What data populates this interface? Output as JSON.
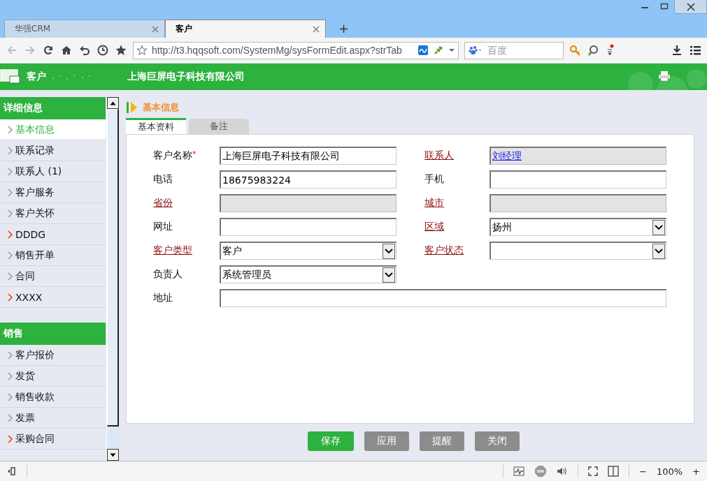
{
  "browser": {
    "tabs": [
      {
        "label": "华强CRM",
        "selected": false
      },
      {
        "label": "客户",
        "selected": true
      }
    ],
    "new_tab": "+",
    "address": "http://t3.hqqsoft.com/SystemMg/sysFormEdit.aspx?strTab",
    "search_placeholder": "百度"
  },
  "app_header": {
    "module": "客户",
    "company": "上海巨屏电子科技有限公司"
  },
  "sidebar": [
    {
      "title": "详细信息",
      "items": [
        {
          "label": "基本信息",
          "selected": true,
          "color": "#999999"
        },
        {
          "label": "联系记录",
          "selected": false,
          "color": "#999999"
        },
        {
          "label": "联系人 (1)",
          "selected": false,
          "color": "#999999"
        },
        {
          "label": "客户服务",
          "selected": false,
          "color": "#999999"
        },
        {
          "label": "客户关怀",
          "selected": false,
          "color": "#999999"
        },
        {
          "label": "DDDG",
          "selected": false,
          "color": "#d9400d"
        },
        {
          "label": "销售开单",
          "selected": false,
          "color": "#999999"
        },
        {
          "label": "合同",
          "selected": false,
          "color": "#999999"
        },
        {
          "label": "XXXX",
          "selected": false,
          "color": "#d9400d"
        }
      ]
    },
    {
      "title": "销售",
      "items": [
        {
          "label": "客户报价",
          "selected": false,
          "color": "#999999"
        },
        {
          "label": "发货",
          "selected": false,
          "color": "#999999"
        },
        {
          "label": "销售收款",
          "selected": false,
          "color": "#999999"
        },
        {
          "label": "发票",
          "selected": false,
          "color": "#999999"
        },
        {
          "label": "采购合同",
          "selected": false,
          "color": "#d9400d"
        }
      ]
    }
  ],
  "section_title": "基本信息",
  "required_mark": "*",
  "form_tabs": [
    {
      "label": "基本资料",
      "selected": true
    },
    {
      "label": "备注",
      "selected": false
    }
  ],
  "fields": [
    {
      "label": "客户名称",
      "required": true,
      "link": false,
      "kind": "text",
      "value": "上海巨屏电子科技有限公司",
      "disabled": false
    },
    {
      "label": "联系人",
      "required": false,
      "link": true,
      "kind": "link",
      "value": "刘经理",
      "disabled": true
    },
    {
      "label": "电话",
      "required": false,
      "link": false,
      "kind": "text",
      "value": "18675983224",
      "disabled": false
    },
    {
      "label": "手机",
      "required": false,
      "link": false,
      "kind": "text",
      "disabled": false
    },
    {
      "label": "省份",
      "required": false,
      "link": true,
      "kind": "text",
      "disabled": true
    },
    {
      "label": "城市",
      "required": false,
      "link": true,
      "kind": "text",
      "disabled": true
    },
    {
      "label": "网址",
      "required": false,
      "link": false,
      "kind": "text",
      "disabled": false
    },
    {
      "label": "区域",
      "required": false,
      "link": true,
      "kind": "select",
      "value": "扬州",
      "disabled": false
    },
    {
      "label": "客户类型",
      "required": false,
      "link": true,
      "kind": "select",
      "value": "客户",
      "disabled": false
    },
    {
      "label": "客户状态",
      "required": false,
      "link": true,
      "kind": "select",
      "disabled": false
    },
    {
      "label": "负责人",
      "required": false,
      "link": false,
      "kind": "select",
      "value": "系统管理员",
      "disabled": false
    },
    {
      "label": "地址",
      "required": false,
      "link": false,
      "kind": "wide",
      "disabled": false
    }
  ],
  "buttons": [
    {
      "label": "保存",
      "primary": true
    },
    {
      "label": "应用",
      "primary": false
    },
    {
      "label": "提醒",
      "primary": false
    },
    {
      "label": "关闭",
      "primary": false
    }
  ],
  "status_bar": {
    "minus": "−",
    "zoom": "100%",
    "plus": "+"
  }
}
